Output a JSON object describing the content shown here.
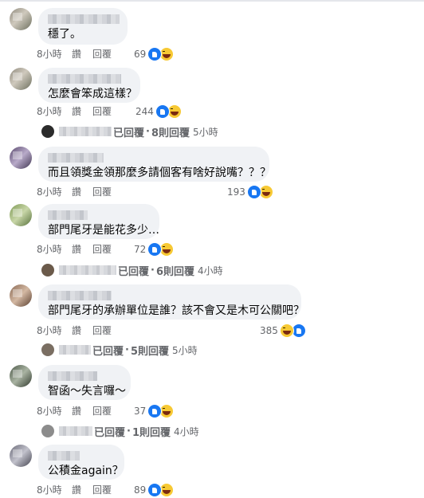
{
  "comments": [
    {
      "text": "穩了。",
      "time": "8小時",
      "like": "讚",
      "reply": "回覆",
      "count": "69",
      "reactions": [
        "like-icon",
        "haha-icon"
      ]
    },
    {
      "text": "怎麼會笨成這樣？",
      "time": "8小時",
      "like": "讚",
      "reply": "回覆",
      "count": "244",
      "reactions": [
        "like-icon",
        "haha-icon"
      ],
      "replies": {
        "replied": "已回覆",
        "sep": "·",
        "count": "8則回覆",
        "time": "5小時"
      }
    },
    {
      "text": "而且領獎金領那麼多請個客有啥好說嘴？？？",
      "time": "8小時",
      "like": "讚",
      "reply": "回覆",
      "count": "193",
      "reactions": [
        "like-icon",
        "haha-icon"
      ]
    },
    {
      "text": "部門尾牙是能花多少…",
      "time": "8小時",
      "like": "讚",
      "reply": "回覆",
      "count": "72",
      "reactions": [
        "like-icon",
        "haha-icon"
      ],
      "replies": {
        "replied": "已回覆",
        "sep": "·",
        "count": "6則回覆",
        "time": "4小時"
      }
    },
    {
      "text": "部門尾牙的承辦單位是誰？該不會又是木可公關吧？",
      "time": "8小時",
      "like": "讚",
      "reply": "回覆",
      "count": "385",
      "reactions": [
        "haha-icon",
        "like-icon"
      ],
      "replies": {
        "replied": "已回覆",
        "sep": "·",
        "count": "5則回覆",
        "time": "5小時"
      }
    },
    {
      "text": "智函～失言囉～",
      "time": "8小時",
      "like": "讚",
      "reply": "回覆",
      "count": "37",
      "reactions": [
        "like-icon",
        "haha-icon"
      ],
      "replies": {
        "replied": "已回覆",
        "sep": "·",
        "count": "1則回覆",
        "time": "4小時"
      }
    },
    {
      "text": "公積金again？",
      "time": "8小時",
      "like": "讚",
      "reply": "回覆",
      "count": "89",
      "reactions": [
        "like-icon",
        "haha-icon"
      ]
    }
  ],
  "colors": {
    "like": "#1877f2",
    "haha": "#f7c934",
    "bubble": "#f0f2f5",
    "meta": "#65676b"
  }
}
